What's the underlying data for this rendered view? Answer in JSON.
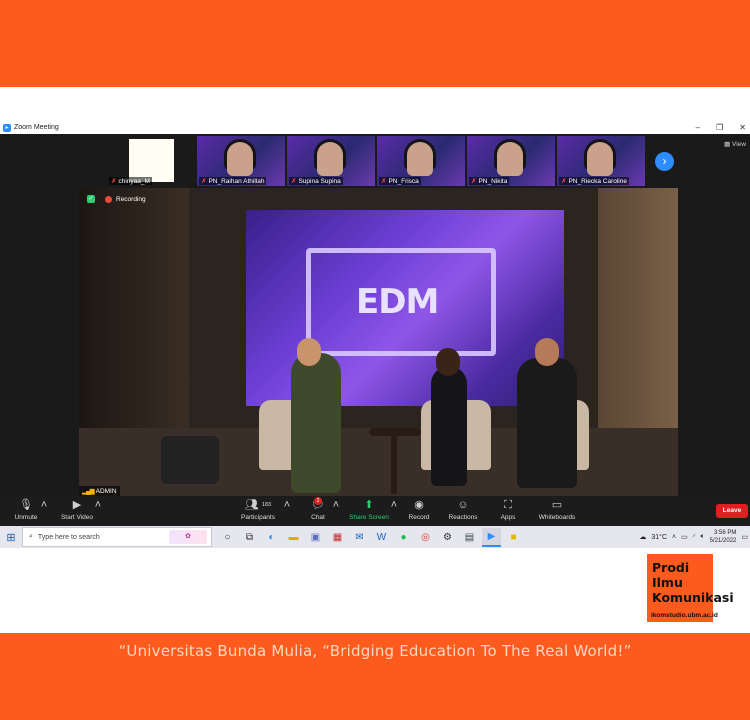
{
  "zoom": {
    "window_title": "Zoom Meeting",
    "win_minimize": "–",
    "win_restore": "❐",
    "win_close": "✕",
    "view_label": "View",
    "recording_label": "Recording",
    "active_speaker": "ADMIN",
    "participants": [
      {
        "name": "chinyaa_M"
      },
      {
        "name": "PN_Raihan Athillah"
      },
      {
        "name": "Supina Supina"
      },
      {
        "name": "PN_Frisca"
      },
      {
        "name": "PN_Nikita"
      },
      {
        "name": "PN_Riecka Caroline"
      }
    ],
    "stage_logo": "EDM",
    "toolbar": {
      "unmute": "Unmute",
      "start_video": "Start Video",
      "participants": "Participants",
      "participant_count": "183",
      "chat": "Chat",
      "chat_badge": "2",
      "share_screen": "Share Screen",
      "record": "Record",
      "reactions": "Reactions",
      "apps": "Apps",
      "whiteboards": "Whiteboards",
      "leave": "Leave"
    }
  },
  "taskbar": {
    "search_placeholder": "Type here to search",
    "weather": "31°C",
    "time": "3:56 PM",
    "date": "5/21/2022"
  },
  "branding": {
    "logo_line1": "Prodi",
    "logo_line2": "Ilmu",
    "logo_line3": "Komunikasi",
    "logo_url": "ikomstudio.ubm.ac.id",
    "tagline": "“Universitas Bunda Mulia, “Bridging Education To The Real World!”"
  },
  "colors": {
    "brand_orange": "#fd5a1e",
    "zoom_blue": "#2d8cff",
    "leave_red": "#e02020",
    "share_green": "#2ecc71"
  }
}
